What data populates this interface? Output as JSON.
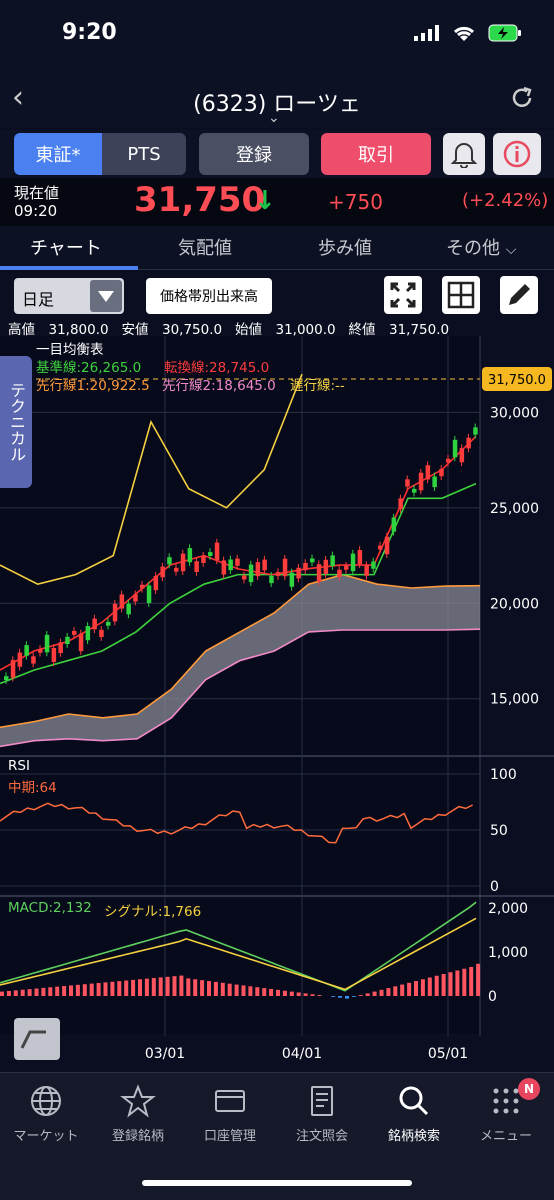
{
  "status": {
    "time": "9:20"
  },
  "nav": {
    "title": "(6323) ローツェ"
  },
  "buttons": {
    "tosho": "東証*",
    "pts": "PTS",
    "register": "登録",
    "trade": "取引"
  },
  "price": {
    "label": "現在値",
    "time": "09:20",
    "value": "31,750",
    "change": "+750",
    "pct": "(+2.42%)",
    "down_color": "#1ec44a",
    "up_color": "#ff4d55"
  },
  "tabs": [
    {
      "label": "チャート"
    },
    {
      "label": "気配値"
    },
    {
      "label": "歩み値"
    },
    {
      "label": "その他"
    }
  ],
  "controls": {
    "period": "日足",
    "volume_button": "価格帯別出来高"
  },
  "ohlc": {
    "high": "高値　31,800.0",
    "low": "安値　30,750.0",
    "open": "始値　31,000.0",
    "close": "終値　31,750.0"
  },
  "technical_tab": "テクニカル",
  "ichimoku": {
    "title": "一目均衡表",
    "kijun": "基準線:26,265.0",
    "tenkan": "転換線:28,745.0",
    "senkou1": "先行線1:20,922.5",
    "senkou2": "先行線2:18,645.0",
    "chikou": "遅行線:--",
    "current_label": "31,750.0"
  },
  "price_axis": [
    "30,000",
    "25,000",
    "20,000",
    "15,000"
  ],
  "rsi": {
    "title": "RSI",
    "mid": "中期:64",
    "axis": [
      "100",
      "50",
      "0"
    ]
  },
  "macd": {
    "macd": "MACD:2,132",
    "signal": "シグナル:1,766",
    "axis": [
      "2,000",
      "1,000",
      "0"
    ]
  },
  "x_axis": [
    "03/01",
    "04/01",
    "05/01"
  ],
  "bottom_nav": [
    {
      "label": "マーケット"
    },
    {
      "label": "登録銘柄"
    },
    {
      "label": "口座管理"
    },
    {
      "label": "注文照会"
    },
    {
      "label": "銘柄検索"
    },
    {
      "label": "メニュー"
    }
  ],
  "badge": "N",
  "chart_data": {
    "type": "line",
    "title": "",
    "y_range": [
      12000,
      34000
    ],
    "series": [
      {
        "name": "基準線",
        "values": [
          15800,
          16500,
          17000,
          17500,
          18500,
          20000,
          21000,
          21500,
          21500,
          21500,
          21500,
          21500,
          25500,
          25500,
          26265
        ]
      },
      {
        "name": "転換線",
        "values": [
          16500,
          17500,
          18000,
          19000,
          20500,
          22000,
          22500,
          21800,
          21500,
          21800,
          22000,
          22000,
          26000,
          27000,
          28745
        ]
      },
      {
        "name": "先行線1",
        "values": [
          13500,
          13800,
          14200,
          14000,
          14200,
          15500,
          17500,
          18500,
          19500,
          21000,
          21500,
          21000,
          20800,
          20900,
          20922
        ]
      },
      {
        "name": "先行線2",
        "values": [
          12500,
          12800,
          12900,
          12800,
          12900,
          14000,
          16000,
          17000,
          17500,
          18500,
          18600,
          18600,
          18600,
          18600,
          18645
        ]
      },
      {
        "name": "遅行線",
        "values": [
          22000,
          21000,
          21500,
          22500,
          29500,
          26000,
          25000,
          27000,
          32000
        ]
      }
    ],
    "current_price": 31750,
    "rsi_mid_last": 64,
    "macd_last": 2132,
    "signal_last": 1766
  }
}
